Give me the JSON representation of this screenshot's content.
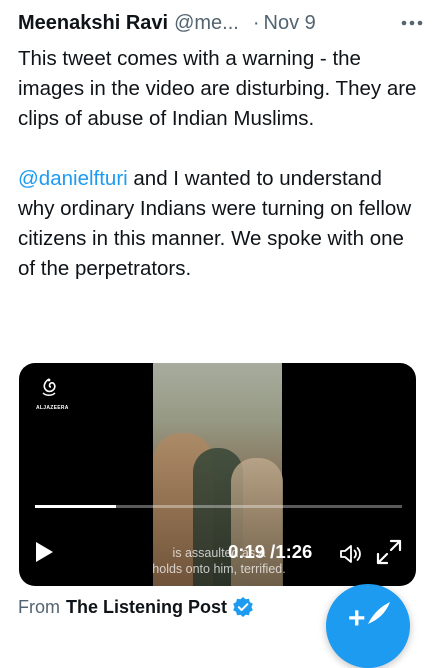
{
  "tweet": {
    "author_name": "Meenakshi Ravi",
    "handle": "@me...",
    "separator": "·",
    "date": "Nov 9",
    "more_icon": "more-horizontal-icon",
    "text_line1": "This tweet comes with a warning - the images in the video are disturbing. They are clips of abuse of Indian Muslims.",
    "mention": "@danielfturi",
    "text_line2_rest": " and I wanted to understand why ordinary Indians were turning on fellow citizens in this manner. We spoke with one of the perpetrators."
  },
  "video": {
    "logo_text": "ALJAZEERA",
    "caption_line1": "is assaulted as a",
    "caption_line2": "holds onto him, terrified.",
    "current_time": "0:19",
    "time_separator": "/",
    "duration": "1:26",
    "progress_fraction": 0.22,
    "play_icon": "play-icon",
    "volume_icon": "volume-icon",
    "fullscreen_icon": "fullscreen-icon"
  },
  "source": {
    "prefix": "From",
    "name": "The Listening Post",
    "verified_icon": "verified-badge-icon"
  },
  "compose": {
    "icon": "compose-tweet-icon",
    "plus": "+"
  },
  "colors": {
    "accent": "#1d9bf0",
    "text": "#0f1419",
    "secondary": "#536471"
  }
}
